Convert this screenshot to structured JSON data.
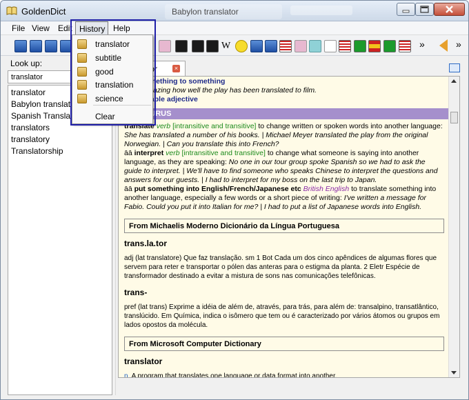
{
  "window": {
    "title": "GoldenDict",
    "background_tab": "Babylon translator"
  },
  "menubar": {
    "file": "File",
    "view": "View",
    "edit": "Edit",
    "history": "History",
    "help": "Help"
  },
  "toolbar": {
    "w_label": "W",
    "more": "»",
    "more2": "»"
  },
  "lookup": {
    "label": "Look up:",
    "value": "translator"
  },
  "word_list": [
    "translator",
    "Babylon translator",
    "Spanish Translator",
    "translators",
    "translatory",
    "Translatorship"
  ],
  "article_tab": {
    "label": "translator",
    "close": "×"
  },
  "history_menu": {
    "items": [
      "translator",
      "subtitle",
      "good",
      "translation",
      "science"
    ],
    "clear": "Clear"
  },
  "article": {
    "top_lines": [
      "to ... something to something",
      "I was amazing how well the play has been translated to film.",
      "translatable adjective"
    ],
    "section_label": "THESAURUS",
    "para1_head": "translate",
    "para1_pos": "verb",
    "para1_tag": "[intransitive and transitive]",
    "para1_def": "to change written or spoken words into another language:",
    "para1_ex": "She has translated a number of his books. | Michael Meyer translated the play from the original Norwegian. | Can you translate this into French?",
    "para2_bullet": "āā",
    "para2_head": "interpret",
    "para2_pos": "verb",
    "para2_tag": "[intransitive and transitive]",
    "para2_def": "to change what someone is saying into another language, as they are speaking:",
    "para2_ex": "No one in our tour group spoke Spanish so we had to ask the guide to interpret. | We'll have to find someone who speaks Chinese to interpret the questions and answers for our guests. | I had to interpret for my boss on the last trip to Japan.",
    "para3_bullet": "āā",
    "para3_head": "put something into English/French/Japanese etc",
    "para3_variant": "British English",
    "para3_def": "to translate something into another language, especially a few words or a short piece of writing:",
    "para3_ex": "I've written a message for Fabio. Could you put it into Italian for me? | I had to put a list of Japanese words into English.",
    "michaelis_header": "From Michaelis Moderno Dicionário da Língua Portuguesa",
    "michaelis_hw1": "trans.la.tor",
    "michaelis_def1": "adj (lat translatore) Que faz translação. sm 1 Bot Cada um dos cinco apêndices de algumas flores que servem para reter e transportar o pólen das anteras para o estigma da planta. 2 Eletr Espécie de transformador destinado a evitar a mistura de sons nas comunicações telefônicas.",
    "michaelis_hw2": "trans-",
    "michaelis_def2": "pref (lat trans) Exprime a idéia de além de, através, para trás, para além de: transalpino, transatlântico, translúcido. Em Química, indica o isômero que tem ou é caracterizado por vários átomos ou grupos em lados opostos da molécula.",
    "mscd_header": "From Microsoft Computer Dictionary",
    "mscd_hw": "translator",
    "mscd_pos": "n.",
    "mscd_def": "A program that translates one language or data format into another."
  },
  "colors": {
    "accent_border": "#1f1fa8",
    "section_bar": "#a58fcc",
    "article_bg": "#fffbe7",
    "close_tab": "#d95b42"
  },
  "icons": [
    "book-icon",
    "folder-icon",
    "smiley-icon",
    "flag-us-icon",
    "flag-brazil-icon",
    "flag-spain-icon",
    "back-arrow-icon"
  ]
}
